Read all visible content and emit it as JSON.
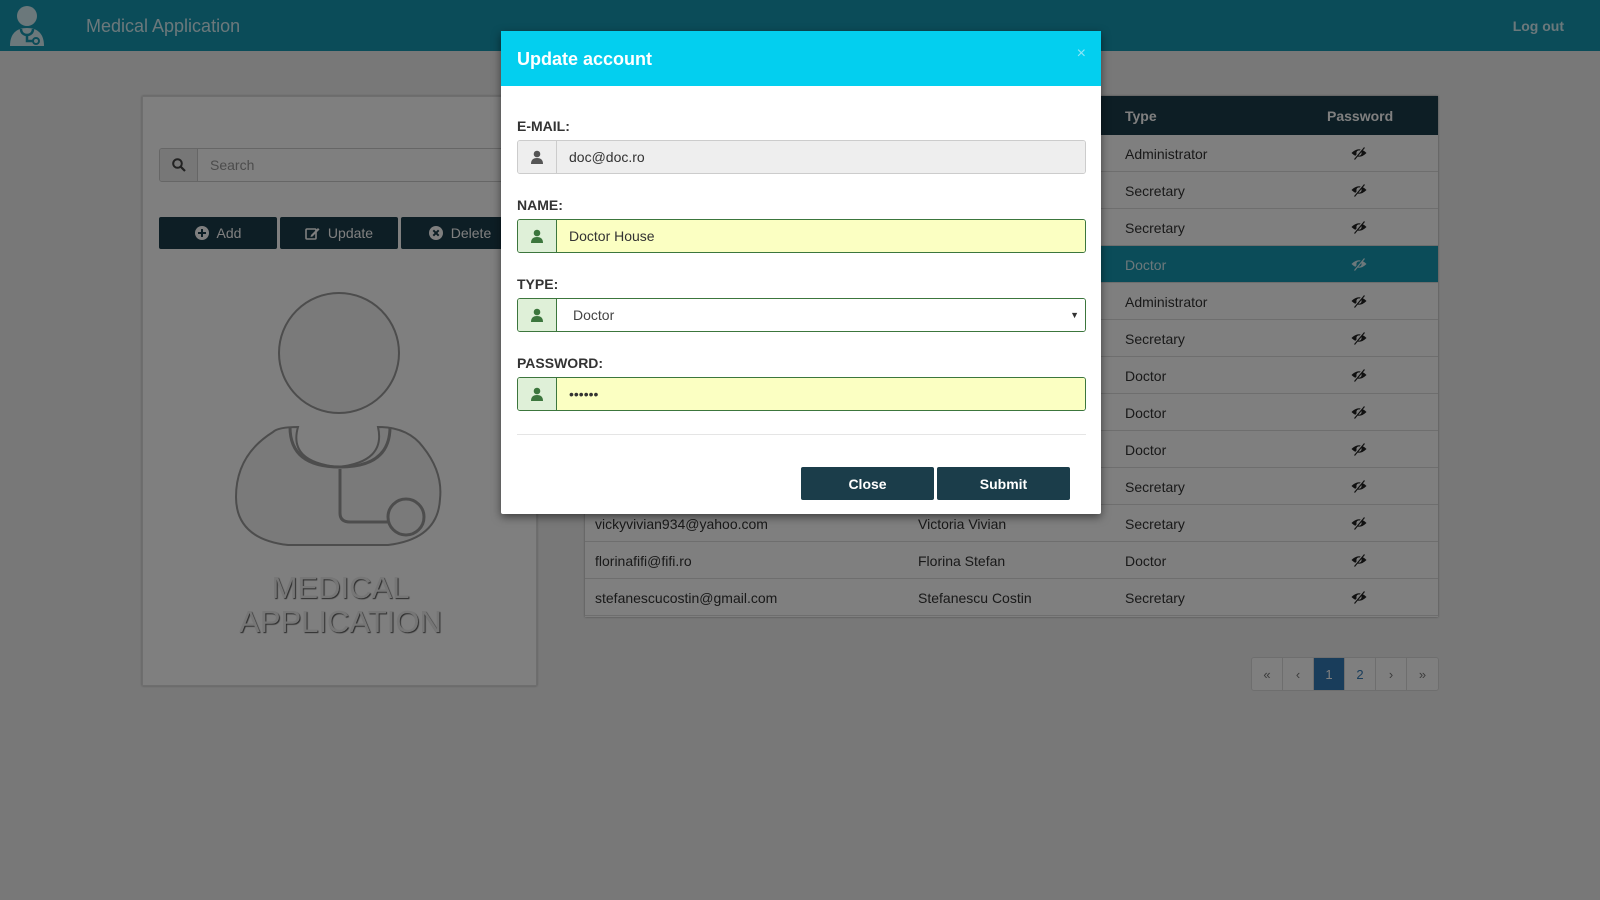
{
  "navbar": {
    "title": "Medical Application",
    "logout": "Log out"
  },
  "left_panel": {
    "search_placeholder": "Search",
    "buttons": {
      "add": "Add",
      "update": "Update",
      "delete": "Delete"
    },
    "logo_line1": "MEDICAL",
    "logo_line2": "APPLICATION"
  },
  "table": {
    "headers": {
      "type": "Type",
      "password": "Password"
    },
    "rows": [
      {
        "email": "",
        "name": "",
        "type": "Administrator",
        "selected": false
      },
      {
        "email": "",
        "name": "",
        "type": "Secretary",
        "selected": false
      },
      {
        "email": "",
        "name": "",
        "type": "Secretary",
        "selected": false
      },
      {
        "email": "",
        "name": "",
        "type": "Doctor",
        "selected": true
      },
      {
        "email": "",
        "name": "",
        "type": "Administrator",
        "selected": false
      },
      {
        "email": "",
        "name": "",
        "type": "Secretary",
        "selected": false
      },
      {
        "email": "",
        "name": "",
        "type": "Doctor",
        "selected": false
      },
      {
        "email": "",
        "name": "",
        "type": "Doctor",
        "selected": false
      },
      {
        "email": "",
        "name": "",
        "type": "Doctor",
        "selected": false
      },
      {
        "email": "",
        "name": "",
        "type": "Secretary",
        "selected": false
      },
      {
        "email": "vickyvivian934@yahoo.com",
        "name": "Victoria Vivian",
        "type": "Secretary",
        "selected": false
      },
      {
        "email": "florinafifi@fifi.ro",
        "name": "Florina Stefan",
        "type": "Doctor",
        "selected": false
      },
      {
        "email": "stefanescucostin@gmail.com",
        "name": "Stefanescu Costin",
        "type": "Secretary",
        "selected": false
      }
    ]
  },
  "pagination": {
    "first": "«",
    "prev": "‹",
    "pages": [
      "1",
      "2"
    ],
    "active_page": "1",
    "next": "›",
    "last": "»"
  },
  "modal": {
    "title": "Update account",
    "close_x": "×",
    "email_label": "E-MAIL:",
    "email_value": "doc@doc.ro",
    "name_label": "NAME:",
    "name_value": "Doctor House",
    "type_label": "TYPE:",
    "type_value": "Doctor",
    "password_label": "PASSWORD:",
    "password_value": "••••••",
    "close_button": "Close",
    "submit_button": "Submit"
  },
  "colors": {
    "navbar": "#1699b3",
    "dark": "#1b3d4a",
    "modal_header": "#03cfef",
    "selected_row": "#1699b3",
    "valid_field": "#fbffc2"
  },
  "icons": {
    "user": "user-icon",
    "search": "search-icon",
    "add": "plus-circle-icon",
    "update": "edit-icon",
    "delete": "times-circle-icon",
    "password": "eye-slash-icon"
  }
}
